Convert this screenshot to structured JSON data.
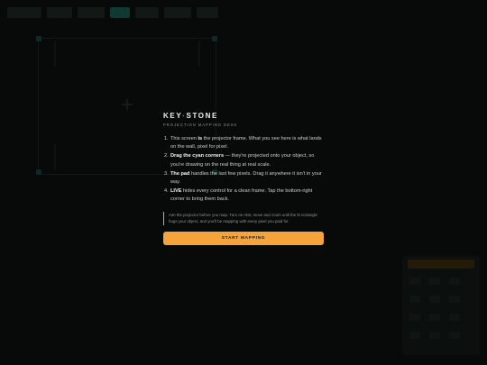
{
  "modal": {
    "brand_left": "KEY",
    "brand_sep": "·",
    "brand_right": "STONE",
    "subtitle": "PROJECTION MAPPING DESK",
    "steps": [
      {
        "pre": "This screen ",
        "bold": "is",
        "post": " the projector frame. What you see here is what lands on the wall, pixel for pixel."
      },
      {
        "pre": "",
        "bold": "Drag the cyan corners",
        "post": " — they're projected onto your object, so you're drawing on the real thing at real scale."
      },
      {
        "pre": "",
        "bold": "The pad",
        "post": " handles the last few pixels. Drag it anywhere it isn't in your way."
      },
      {
        "pre": "",
        "bold": "LIVE",
        "post": " hides every control for a clean frame. Tap the bottom-right corner to bring them back."
      }
    ],
    "note": "Aim the projector before you map. Turn on AIM, move and zoom until the lit rectangle hugs your object, and you'll be mapping with every pixel you paid for.",
    "start_label": "START MAPPING"
  },
  "colors": {
    "accent": "#f6a43a",
    "cyan": "#2fc6b3",
    "background": "#070a09"
  }
}
